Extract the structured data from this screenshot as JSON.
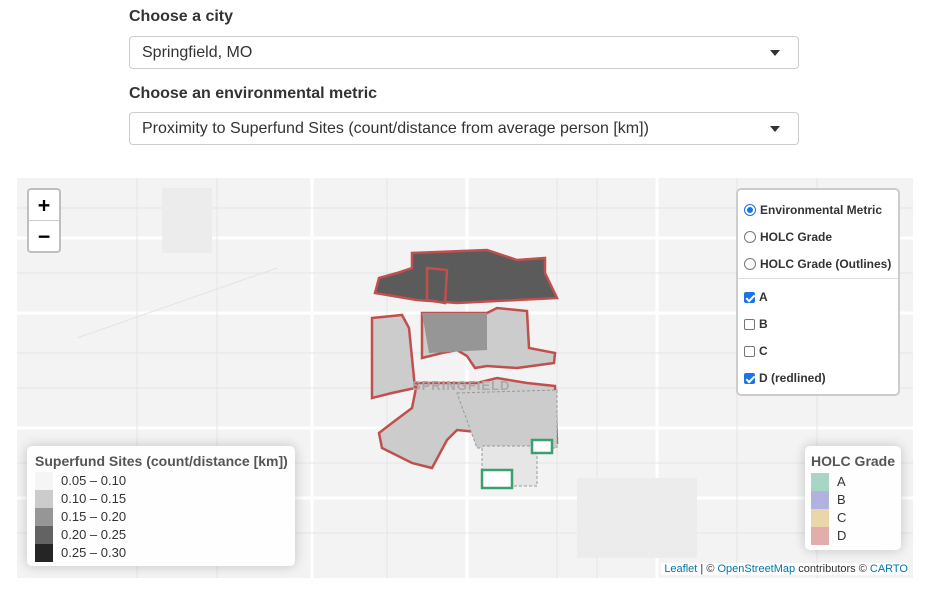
{
  "city_control": {
    "label": "Choose a city",
    "selected": "Springfield, MO"
  },
  "metric_control": {
    "label": "Choose an environmental metric",
    "selected": "Proximity to Superfund Sites (count/distance from average person [km])"
  },
  "map": {
    "zoom_in": "+",
    "zoom_out": "−",
    "layers": {
      "radios": [
        {
          "label": "Environmental Metric",
          "checked": true
        },
        {
          "label": "HOLC Grade",
          "checked": false
        },
        {
          "label": "HOLC Grade (Outlines)",
          "checked": false
        }
      ],
      "checkboxes": [
        {
          "label": "A",
          "checked": true
        },
        {
          "label": "B",
          "checked": false
        },
        {
          "label": "C",
          "checked": false
        },
        {
          "label": "D (redlined)",
          "checked": true
        }
      ]
    },
    "metric_legend": {
      "title": "Superfund Sites (count/distance [km])",
      "items": [
        {
          "label": "0.05 – 0.10",
          "color": "#f5f5f5"
        },
        {
          "label": "0.10 – 0.15",
          "color": "#cccccc"
        },
        {
          "label": "0.15 – 0.20",
          "color": "#969696"
        },
        {
          "label": "0.20 – 0.25",
          "color": "#636363"
        },
        {
          "label": "0.25 – 0.30",
          "color": "#252525"
        }
      ]
    },
    "holc_legend": {
      "title": "HOLC Grade",
      "items": [
        {
          "label": "A",
          "color": "#a8d5c4"
        },
        {
          "label": "B",
          "color": "#b2b2e0"
        },
        {
          "label": "C",
          "color": "#ead6a8"
        },
        {
          "label": "D",
          "color": "#e2aeac"
        }
      ]
    },
    "map_city_label": "SPRINGFIELD",
    "attribution": {
      "leaflet": "Leaflet",
      "sep": " | © ",
      "osm": "OpenStreetMap",
      "mid": " contributors © ",
      "carto": "CARTO"
    },
    "colors": {
      "redlined_outline": "#c0504d",
      "grade_a_outline": "#3aa06e",
      "accent": "#1a73e8"
    }
  }
}
